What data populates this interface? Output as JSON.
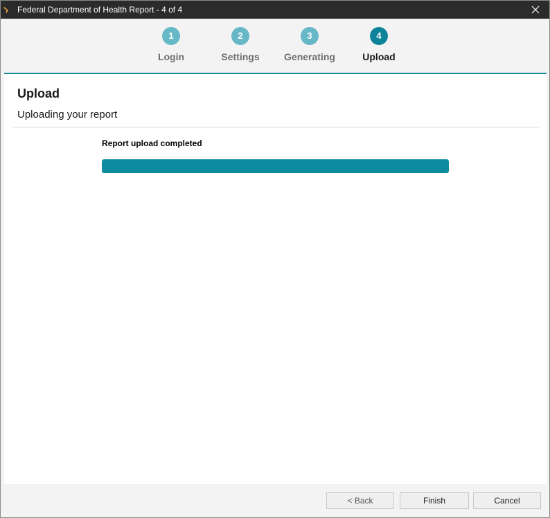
{
  "window": {
    "title": "Federal Department of Health Report - 4 of 4",
    "app_icon": "app-logo-icon",
    "close_icon": "close-icon"
  },
  "wizard": {
    "steps": [
      {
        "number": "1",
        "label": "Login",
        "state": "complete"
      },
      {
        "number": "2",
        "label": "Settings",
        "state": "complete"
      },
      {
        "number": "3",
        "label": "Generating",
        "state": "complete"
      },
      {
        "number": "4",
        "label": "Upload",
        "state": "active"
      }
    ]
  },
  "page": {
    "title": "Upload",
    "subtitle": "Uploading your report"
  },
  "upload": {
    "status": "Report upload completed",
    "progress_percent": 100
  },
  "footer": {
    "back_label": "< Back",
    "finish_label": "Finish",
    "cancel_label": "Cancel"
  },
  "colors": {
    "accent": "#16899b",
    "step_complete": "#67b8c6",
    "step_active": "#0f8399",
    "progress_fill": "#0d8ba0",
    "titlebar": "#2b2b2b"
  }
}
